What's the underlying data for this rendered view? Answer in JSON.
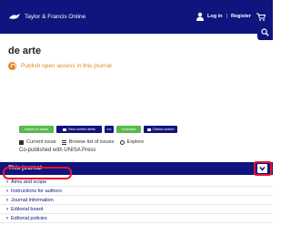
{
  "header": {
    "logo_text": "Taylor & Francis Online",
    "login": "Log in",
    "register": "Register",
    "separator": "|"
  },
  "journal": {
    "title": "de arte",
    "open_access": "Publish open access in this journal"
  },
  "buttons": [
    {
      "label": "Submit an article"
    },
    {
      "label": "New content alerts"
    },
    {
      "label": "RSS"
    },
    {
      "label": "Subscribe"
    },
    {
      "label": "Citation search"
    }
  ],
  "links": {
    "current_issue": "Current issue",
    "browse": "Browse list of issues",
    "explore": "Explore"
  },
  "copublished": "Co-published with UNISA Press",
  "this_journal": {
    "heading": "This journal",
    "items": [
      {
        "label": "Aims and scope"
      },
      {
        "label": "Instructions for authors"
      },
      {
        "label": "Journal information"
      },
      {
        "label": "Editorial board"
      },
      {
        "label": "Editorial policies"
      }
    ]
  },
  "colors": {
    "navy": "#10147e",
    "green": "#58b94c",
    "orange": "#e4881f",
    "highlight_red": "#e2152b"
  }
}
